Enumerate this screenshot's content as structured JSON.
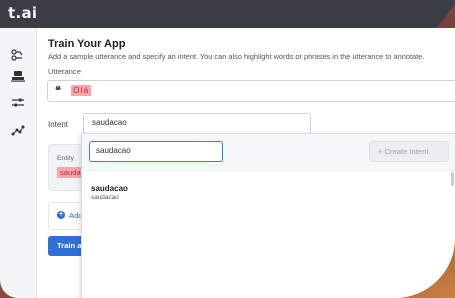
{
  "app": {
    "brand": "t.ai"
  },
  "sidebar": {
    "items": [
      {
        "icon": "flow-icon"
      },
      {
        "icon": "train-icon"
      },
      {
        "icon": "sliders-icon"
      },
      {
        "icon": "analytics-icon"
      }
    ]
  },
  "main": {
    "title": "Train Your App",
    "subtitle": "Add a sample utterance and specify an intent. You can also highlight words or phrases in the utterance to annotate.",
    "utterance_label": "Utterance",
    "utterance_quote": "❝",
    "utterance_text": "Olá",
    "intent_label": "Intent",
    "intent_value": "saudacao",
    "entity_label": "Entity",
    "entity_chip": "sauda",
    "add_label": "Add",
    "train_label": "Train a"
  },
  "dropdown": {
    "search_value": "saudacao",
    "create_label": "+ Create Intent",
    "items": [
      {
        "title": "saudacao",
        "subtitle": "saudacao"
      }
    ]
  },
  "colors": {
    "accent": "#2f6fd6",
    "highlight_bg": "#f3a9ae",
    "highlight_text": "#c2263a",
    "topbar": "#3a3d44"
  }
}
